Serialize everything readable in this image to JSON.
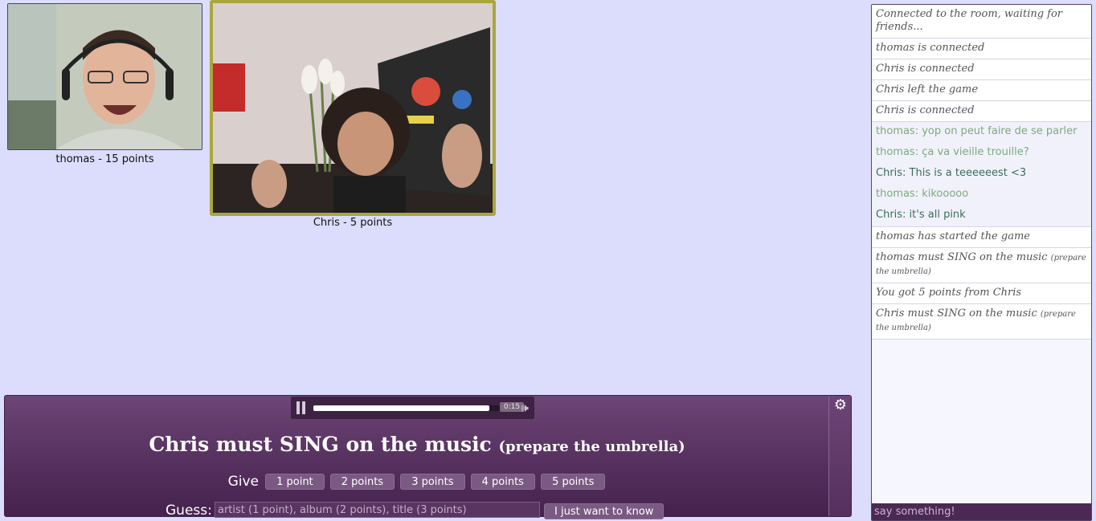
{
  "players": {
    "thomas": {
      "label": "thomas - 15 points"
    },
    "chris": {
      "label": "Chris - 5 points"
    }
  },
  "player": {
    "time": "0:15",
    "progress": 0.93,
    "pause_icon": "pause-icon",
    "volume_icon": "volume-icon",
    "settings_icon": "gear-icon"
  },
  "task": {
    "main": "Chris must SING on the music",
    "sub": "(prepare the umbrella)"
  },
  "give": {
    "label": "Give",
    "buttons": [
      "1 point",
      "2 points",
      "3 points",
      "4 points",
      "5 points"
    ]
  },
  "guess": {
    "label": "Guess:",
    "placeholder": "artist (1 point), album (2 points), title (3 points)",
    "know_button": "I just want to know"
  },
  "chat": {
    "placeholder": "say something!",
    "messages": [
      {
        "text": "Connected to the room, waiting for friends..."
      },
      {
        "text": "thomas is connected"
      },
      {
        "text": "Chris is connected"
      },
      {
        "text": "Chris left the game"
      },
      {
        "text": "Chris is connected"
      },
      {
        "text": "thomas: yop on peut faire de se parler"
      },
      {
        "text": "thomas: ça va vieille trouille?"
      },
      {
        "text": "Chris: This is a teeeeeest <3"
      },
      {
        "text": "thomas: kikooooo"
      },
      {
        "text": "Chris: it's all pink"
      },
      {
        "text": "thomas has started the game"
      },
      {
        "text": "thomas must SING on the music",
        "small": "(prepare the umbrella)"
      },
      {
        "text": "You got 5 points from Chris"
      },
      {
        "text": "Chris must SING on the music",
        "small": "(prepare the umbrella)"
      }
    ]
  },
  "colors": {
    "background": "#dcdcfd",
    "panel": "#5a3462",
    "active_border": "#a9a73b",
    "chat_thomas": "#7daa7d",
    "chat_chris": "#3b6f5a"
  }
}
